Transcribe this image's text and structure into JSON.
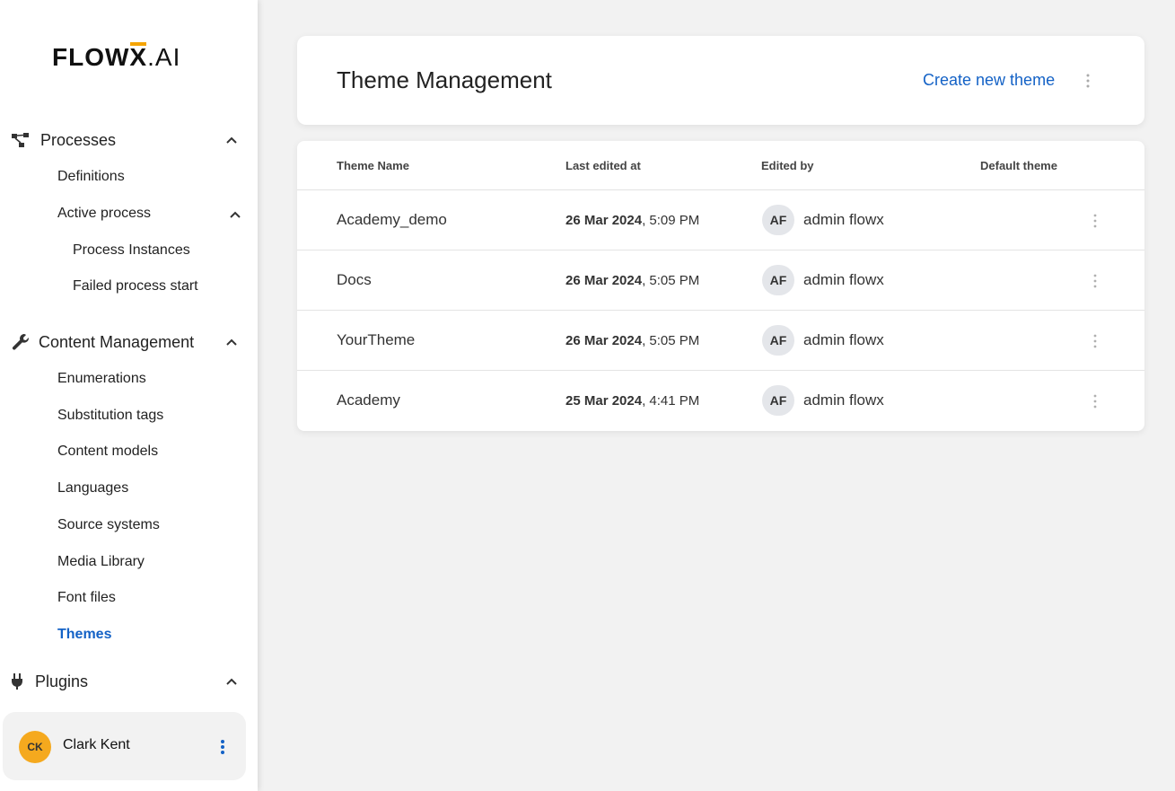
{
  "brand": {
    "logo_main": "FLOW",
    "logo_x": "X",
    "logo_ai": ".AI",
    "accent": "#f5a400"
  },
  "sidebar": {
    "groups": [
      {
        "label": "Processes",
        "icon": "process-icon"
      },
      {
        "label": "Content Management",
        "icon": "wrench-icon"
      },
      {
        "label": "Plugins",
        "icon": "plug-icon"
      }
    ],
    "processes_items": [
      "Definitions",
      "Active process"
    ],
    "active_process_items": [
      "Process Instances",
      "Failed process start"
    ],
    "content_items": [
      "Enumerations",
      "Substitution tags",
      "Content models",
      "Languages",
      "Source systems",
      "Media Library",
      "Font files",
      "Themes"
    ],
    "active_item": "Themes"
  },
  "user": {
    "initials": "CK",
    "name": "Clark Kent"
  },
  "header": {
    "title": "Theme Management",
    "create_label": "Create new theme"
  },
  "table": {
    "columns": [
      "Theme Name",
      "Last edited at",
      "Edited by",
      "Default theme"
    ],
    "rows": [
      {
        "name": "Academy_demo",
        "date": "26 Mar 2024",
        "time": ", 5:09 PM",
        "initials": "AF",
        "user": "admin flowx"
      },
      {
        "name": "Docs",
        "date": "26 Mar 2024",
        "time": ", 5:05 PM",
        "initials": "AF",
        "user": "admin flowx"
      },
      {
        "name": "YourTheme",
        "date": "26 Mar 2024",
        "time": ", 5:05 PM",
        "initials": "AF",
        "user": "admin flowx"
      },
      {
        "name": "Academy",
        "date": "25 Mar 2024",
        "time": ", 4:41 PM",
        "initials": "AF",
        "user": "admin flowx"
      }
    ]
  },
  "colors": {
    "link": "#1462c6",
    "avatar": "#f5a91e"
  }
}
